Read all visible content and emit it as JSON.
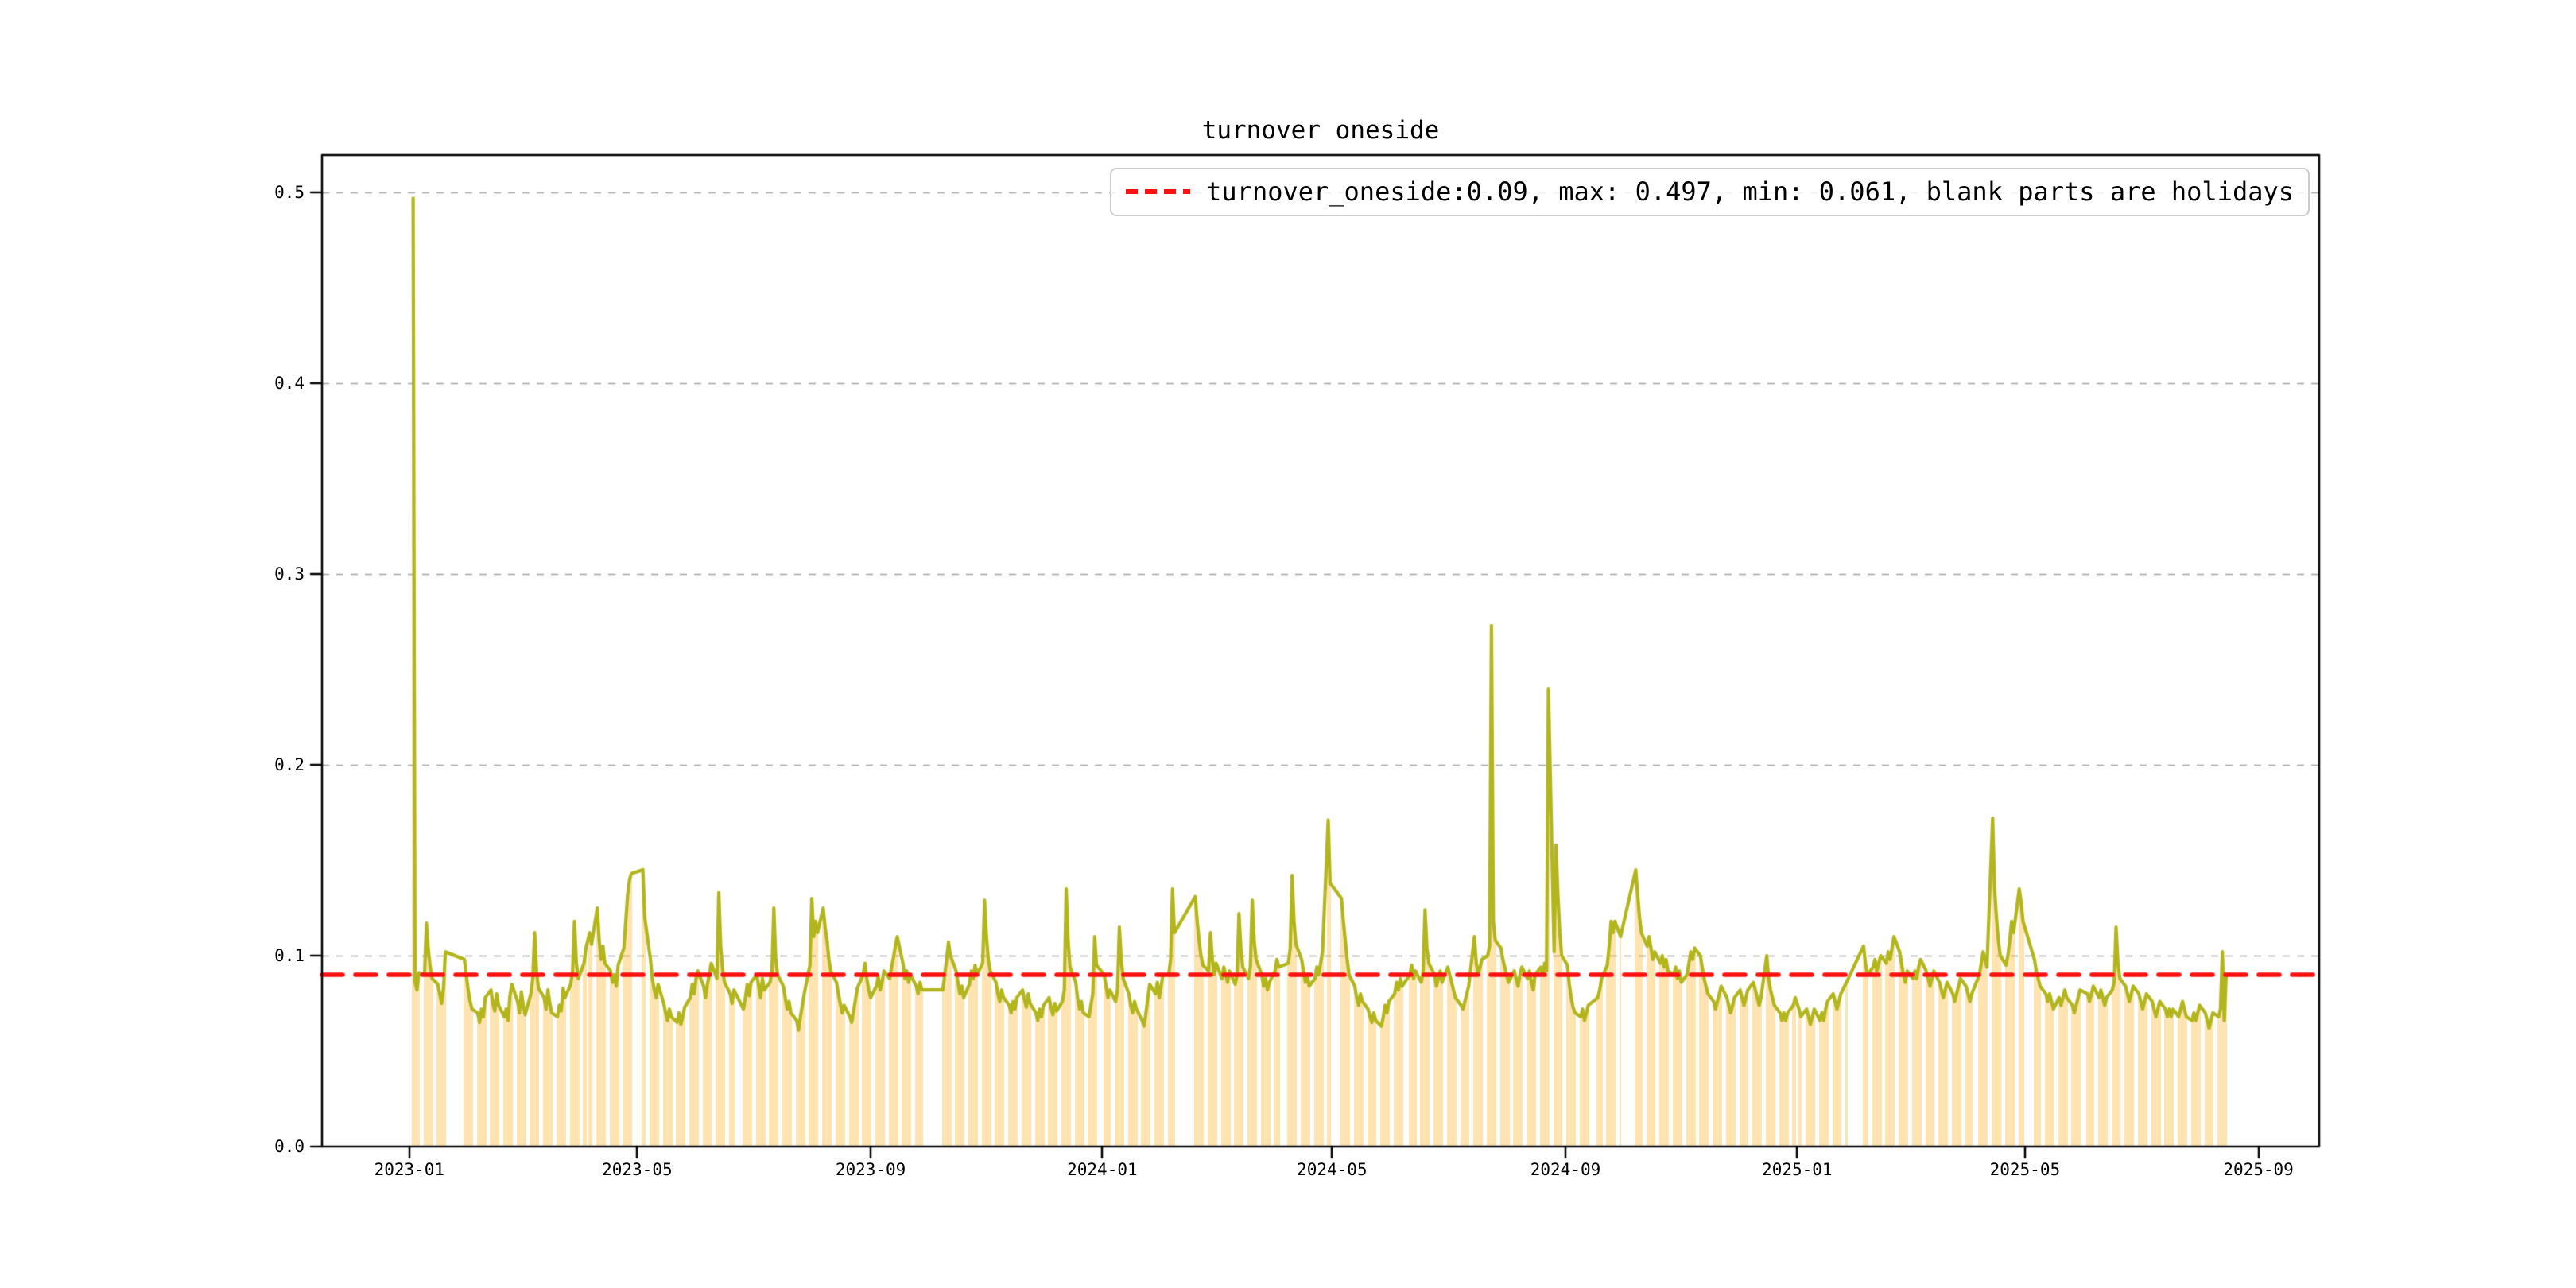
{
  "title": "turnover oneside",
  "legend": {
    "label": "turnover_oneside:0.09, max: 0.497, min: 0.061, blank parts are holidays"
  },
  "stats": {
    "turnover_oneside": 0.09,
    "max": 0.497,
    "min": 0.061,
    "note": "blank parts are holidays"
  },
  "colors": {
    "line": "#b2b51c",
    "bar_fill": "rgba(255,165,0,0.31)",
    "threshold_line": "#ff1111",
    "grid": "#aaaaaa",
    "spine": "#000000",
    "legend_border": "#cccccc",
    "text": "#000000"
  },
  "axes": {
    "y_ticks": [
      "0.0",
      "0.1",
      "0.2",
      "0.3",
      "0.4",
      "0.5"
    ],
    "y_tick_values": [
      0.0,
      0.1,
      0.2,
      0.3,
      0.4,
      0.5
    ],
    "x_ticks": [
      "2023-01",
      "2023-05",
      "2023-09",
      "2024-01",
      "2024-05",
      "2024-09",
      "2025-01",
      "2025-05",
      "2025-09"
    ],
    "x_tick_dates": [
      "2023-01-01",
      "2023-05-01",
      "2023-09-01",
      "2024-01-01",
      "2024-05-01",
      "2024-09-01",
      "2025-01-01",
      "2025-05-01",
      "2025-09-01"
    ],
    "x_range": [
      "2022-11-16",
      "2025-10-03"
    ],
    "y_range": [
      0.0,
      0.5196
    ]
  },
  "chart_data": {
    "type": "line",
    "title": "turnover oneside",
    "xlabel": "",
    "ylabel": "",
    "legend_position": "upper right",
    "grid": "horizontal dashed",
    "threshold": 0.09,
    "series_name": "turnover_oneside",
    "latest": 0.09,
    "max": 0.497,
    "min": 0.061,
    "note": "daily turnover drawn as olive line with orange bars under each trading day; blank columns are market holidays/weekends",
    "resolution": "weekly rows of 5 weekday values (Mon-Fri), null = market closed",
    "week_start": "2023-01-02",
    "weeks": [
      [
        null,
        0.497,
        0.086,
        0.082,
        0.091
      ],
      [
        0.09,
        0.117,
        0.103,
        0.094,
        0.088
      ],
      [
        0.085,
        0.08,
        0.075,
        0.083,
        0.102
      ],
      [
        null,
        null,
        null,
        null,
        null
      ],
      [
        0.098,
        0.09,
        0.082,
        0.076,
        0.072
      ],
      [
        0.07,
        0.065,
        0.072,
        0.068,
        0.078
      ],
      [
        0.082,
        0.075,
        0.071,
        0.08,
        0.074
      ],
      [
        0.068,
        0.072,
        0.066,
        0.079,
        0.085
      ],
      [
        0.076,
        0.07,
        0.081,
        0.074,
        0.069
      ],
      [
        0.08,
        0.088,
        0.112,
        0.092,
        0.083
      ],
      [
        0.078,
        0.072,
        0.082,
        0.075,
        0.07
      ],
      [
        0.068,
        0.074,
        0.071,
        0.083,
        0.078
      ],
      [
        0.085,
        0.092,
        0.118,
        0.096,
        0.088
      ],
      [
        0.096,
        0.104,
        null,
        0.112,
        0.106
      ],
      [
        0.125,
        0.108,
        0.098,
        0.105,
        0.096
      ],
      [
        0.092,
        0.086,
        0.09,
        0.084,
        0.095
      ],
      [
        0.104,
        0.118,
        0.132,
        0.14,
        0.143
      ],
      [
        null,
        null,
        null,
        0.145,
        0.12
      ],
      [
        0.098,
        0.088,
        0.082,
        0.078,
        0.085
      ],
      [
        0.075,
        0.07,
        0.066,
        0.072,
        0.068
      ],
      [
        0.065,
        0.07,
        0.064,
        0.068,
        0.073
      ],
      [
        0.078,
        0.085,
        0.08,
        0.088,
        0.092
      ],
      [
        0.084,
        0.078,
        0.085,
        0.09,
        0.096
      ],
      [
        0.088,
        0.133,
        0.105,
        0.093,
        0.086
      ],
      [
        0.08,
        0.075,
        0.082,
        null,
        null
      ],
      [
        0.072,
        0.078,
        0.085,
        0.079,
        0.086
      ],
      [
        0.09,
        0.084,
        0.078,
        0.088,
        0.082
      ],
      [
        0.086,
        0.092,
        0.125,
        0.098,
        0.09
      ],
      [
        0.084,
        0.078,
        0.072,
        0.076,
        0.07
      ],
      [
        0.066,
        0.061,
        0.068,
        0.074,
        0.08
      ],
      [
        0.095,
        0.13,
        0.11,
        0.118,
        0.112
      ],
      [
        0.125,
        0.115,
        0.108,
        0.098,
        0.092
      ],
      [
        0.086,
        0.08,
        0.075,
        0.07,
        0.074
      ],
      [
        0.068,
        0.065,
        0.071,
        0.077,
        0.083
      ],
      [
        0.09,
        0.096,
        0.088,
        0.082,
        0.078
      ],
      [
        0.084,
        0.089,
        0.082,
        0.086,
        0.092
      ],
      [
        0.088,
        0.094,
        0.099,
        0.105,
        0.11
      ],
      [
        0.096,
        0.088,
        0.092,
        0.086,
        0.09
      ],
      [
        0.084,
        0.08,
        0.086,
        0.082,
        null
      ],
      [
        null,
        null,
        null,
        null,
        null
      ],
      [
        0.082,
        0.09,
        0.098,
        0.107,
        0.1
      ],
      [
        0.092,
        0.086,
        0.08,
        0.084,
        0.078
      ],
      [
        0.085,
        0.092,
        0.088,
        0.095,
        0.09
      ],
      [
        0.096,
        0.129,
        0.11,
        0.098,
        0.092
      ],
      [
        0.086,
        0.08,
        0.076,
        0.082,
        0.078
      ],
      [
        0.074,
        0.07,
        0.076,
        0.072,
        0.078
      ],
      [
        0.082,
        0.077,
        0.073,
        0.08,
        0.075
      ],
      [
        0.07,
        0.066,
        0.072,
        0.068,
        0.074
      ],
      [
        0.078,
        0.073,
        0.069,
        0.075,
        0.071
      ],
      [
        0.076,
        0.082,
        0.135,
        0.108,
        0.094
      ],
      [
        0.086,
        0.078,
        0.072,
        0.076,
        0.07
      ],
      [
        0.068,
        0.074,
        0.08,
        0.11,
        0.095
      ],
      [
        null,
        0.09,
        0.084,
        0.078,
        0.082
      ],
      [
        0.076,
        0.082,
        0.115,
        0.098,
        0.088
      ],
      [
        0.08,
        0.074,
        0.07,
        0.076,
        0.072
      ],
      [
        0.066,
        0.063,
        0.07,
        0.078,
        0.085
      ],
      [
        0.08,
        0.086,
        0.078,
        0.084,
        0.09
      ],
      [
        0.09,
        0.098,
        0.135,
        0.112,
        null
      ],
      [
        null,
        null,
        null,
        null,
        null
      ],
      [
        0.131,
        0.118,
        0.108,
        0.1,
        0.095
      ],
      [
        0.092,
        0.112,
        0.098,
        0.09,
        0.096
      ],
      [
        0.088,
        0.094,
        0.09,
        0.086,
        0.092
      ],
      [
        0.085,
        0.09,
        0.122,
        0.104,
        0.094
      ],
      [
        0.088,
        0.094,
        0.129,
        0.108,
        0.098
      ],
      [
        0.09,
        0.084,
        0.088,
        0.082,
        0.086
      ],
      [
        0.092,
        0.098,
        0.094,
        null,
        null
      ],
      [
        0.096,
        0.104,
        0.142,
        0.118,
        0.106
      ],
      [
        0.098,
        0.092,
        0.086,
        0.09,
        0.084
      ],
      [
        0.088,
        0.094,
        0.09,
        0.096,
        0.102
      ],
      [
        0.171,
        0.138,
        null,
        null,
        null
      ],
      [
        0.13,
        0.118,
        0.108,
        0.098,
        0.09
      ],
      [
        0.084,
        0.078,
        0.074,
        0.08,
        0.076
      ],
      [
        0.072,
        0.068,
        0.065,
        0.07,
        0.066
      ],
      [
        0.063,
        0.068,
        0.074,
        0.07,
        0.076
      ],
      [
        0.08,
        0.086,
        0.082,
        0.088,
        0.084
      ],
      [
        null,
        0.09,
        0.095,
        0.088,
        0.092
      ],
      [
        0.086,
        0.092,
        0.124,
        0.104,
        0.096
      ],
      [
        0.09,
        0.084,
        0.088,
        0.092,
        0.086
      ],
      [
        0.094,
        0.09,
        0.086,
        0.082,
        0.078
      ],
      [
        0.074,
        0.072,
        0.076,
        0.08,
        0.084
      ],
      [
        0.11,
        0.096,
        0.09,
        0.094,
        0.098
      ],
      [
        0.1,
        0.105,
        0.273,
        0.118,
        0.108
      ],
      [
        0.104,
        0.098,
        0.094,
        0.09,
        0.086
      ],
      [
        0.092,
        0.088,
        0.084,
        0.09,
        0.094
      ],
      [
        0.088,
        0.092,
        0.086,
        0.082,
        0.09
      ],
      [
        0.094,
        0.09,
        0.096,
        0.092,
        0.24
      ],
      [
        0.102,
        0.158,
        0.132,
        0.112,
        0.1
      ],
      [
        0.095,
        0.085,
        0.078,
        0.073,
        0.07
      ],
      [
        0.068,
        0.072,
        0.066,
        0.07,
        0.074
      ],
      [
        null,
        null,
        0.078,
        0.082,
        0.088
      ],
      [
        0.095,
        0.105,
        0.118,
        0.112,
        0.118
      ],
      [
        0.11,
        null,
        null,
        null,
        null
      ],
      [
        null,
        0.145,
        0.132,
        0.12,
        0.112
      ],
      [
        0.105,
        0.11,
        0.104,
        0.098,
        0.102
      ],
      [
        0.096,
        0.1,
        0.094,
        0.098,
        0.092
      ],
      [
        0.09,
        0.094,
        0.088,
        0.092,
        0.086
      ],
      [
        0.09,
        0.096,
        0.102,
        0.098,
        0.104
      ],
      [
        0.1,
        0.094,
        0.088,
        0.084,
        0.08
      ],
      [
        0.076,
        0.072,
        0.076,
        0.08,
        0.084
      ],
      [
        0.078,
        0.074,
        0.07,
        0.074,
        0.078
      ],
      [
        0.082,
        0.078,
        0.074,
        0.078,
        0.082
      ],
      [
        0.086,
        0.082,
        0.078,
        0.074,
        0.078
      ],
      [
        0.1,
        0.088,
        0.082,
        0.078,
        0.074
      ],
      [
        0.07,
        0.066,
        0.07,
        0.066,
        0.07
      ],
      [
        0.074,
        0.078,
        null,
        0.072,
        0.068
      ],
      [
        0.072,
        0.068,
        0.064,
        0.068,
        0.072
      ],
      [
        0.066,
        0.07,
        0.066,
        0.072,
        0.076
      ],
      [
        0.08,
        0.076,
        0.072,
        0.076,
        0.08
      ],
      [
        0.086,
        null,
        null,
        null,
        null
      ],
      [
        null,
        null,
        0.105,
        0.096,
        0.09
      ],
      [
        0.094,
        0.098,
        0.092,
        0.096,
        0.1
      ],
      [
        0.096,
        0.102,
        0.098,
        0.104,
        0.11
      ],
      [
        0.102,
        0.096,
        0.09,
        0.086,
        0.092
      ],
      [
        0.088,
        0.092,
        0.088,
        0.094,
        0.098
      ],
      [
        0.092,
        0.088,
        0.084,
        0.088,
        0.092
      ],
      [
        0.086,
        0.082,
        0.078,
        0.082,
        0.086
      ],
      [
        0.08,
        0.076,
        0.08,
        0.084,
        0.088
      ],
      [
        0.084,
        0.08,
        0.076,
        0.08,
        null
      ],
      [
        0.09,
        0.096,
        0.102,
        0.098,
        0.094
      ],
      [
        0.172,
        0.135,
        0.12,
        0.108,
        0.1
      ],
      [
        0.095,
        0.1,
        0.108,
        0.118,
        0.112
      ],
      [
        0.135,
        0.128,
        0.118,
        null,
        null
      ],
      [
        null,
        0.098,
        0.092,
        0.088,
        0.084
      ],
      [
        0.08,
        0.076,
        0.08,
        0.076,
        0.072
      ],
      [
        0.078,
        0.074,
        0.078,
        0.082,
        0.078
      ],
      [
        0.074,
        0.07,
        0.074,
        0.078,
        0.082
      ],
      [
        null,
        0.08,
        0.076,
        0.08,
        0.084
      ],
      [
        0.078,
        0.082,
        0.078,
        0.074,
        0.078
      ],
      [
        0.082,
        0.086,
        0.115,
        0.096,
        0.088
      ],
      [
        0.084,
        0.08,
        0.076,
        0.08,
        0.084
      ],
      [
        0.08,
        0.076,
        0.072,
        0.076,
        0.08
      ],
      [
        0.076,
        0.072,
        0.068,
        0.072,
        0.076
      ],
      [
        0.072,
        0.068,
        0.072,
        0.068,
        0.072
      ],
      [
        0.068,
        0.072,
        0.076,
        0.072,
        0.068
      ],
      [
        0.066,
        0.07,
        0.066,
        0.07,
        0.074
      ],
      [
        0.07,
        0.066,
        0.062,
        0.066,
        0.07
      ],
      [
        0.068,
        0.072,
        0.102,
        0.066,
        0.09
      ]
    ]
  }
}
